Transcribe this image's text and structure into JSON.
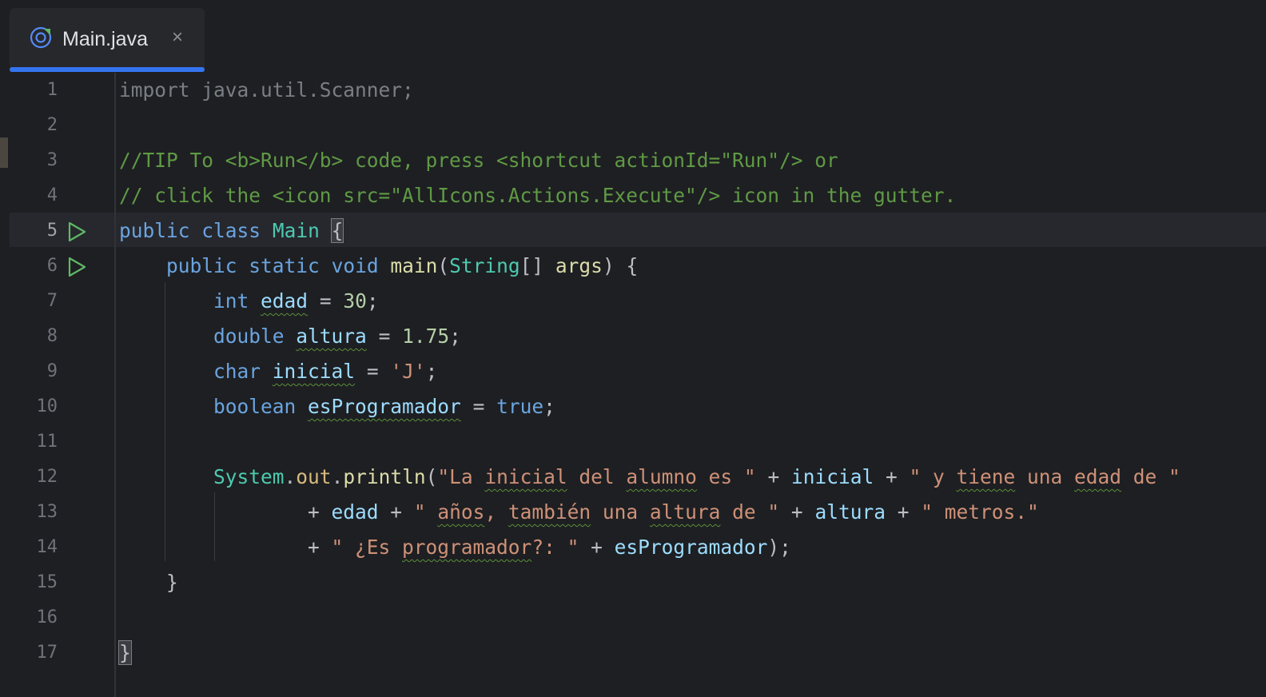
{
  "tab": {
    "title": "Main.java",
    "close_glyph": "×",
    "icon": "java-class-icon",
    "underline_color": "#3574f0"
  },
  "colors": {
    "background": "#1e1f22",
    "keyword": "#6aa4e0",
    "string": "#ce9178",
    "comment": "#5f9a45"
  },
  "lines": [
    {
      "n": "1",
      "code": "import java.util.Scanner;"
    },
    {
      "n": "2",
      "code": ""
    },
    {
      "n": "3",
      "code": "//TIP To <b>Run</b> code, press <shortcut actionId=\"Run\"/> or"
    },
    {
      "n": "4",
      "code": "// click the <icon src=\"AllIcons.Actions.Execute\"/> icon in the gutter."
    },
    {
      "n": "5",
      "code": "public class Main {"
    },
    {
      "n": "6",
      "code": "public static void main(String[] args) {"
    },
    {
      "n": "7",
      "code": "int edad = 30;"
    },
    {
      "n": "8",
      "code": "double altura = 1.75;"
    },
    {
      "n": "9",
      "code": "char inicial = 'J';"
    },
    {
      "n": "10",
      "code": "boolean esProgramador = true;"
    },
    {
      "n": "11",
      "code": ""
    },
    {
      "n": "12",
      "code": "System.out.println(\"La inicial del alumno es \" + inicial + \" y tiene una edad de \""
    },
    {
      "n": "13",
      "code": "+ edad + \" años, también una altura de \" + altura + \" metros.\""
    },
    {
      "n": "14",
      "code": "+ \" ¿Es programador?: \" + esProgramador);"
    },
    {
      "n": "15",
      "code": "}"
    },
    {
      "n": "16",
      "code": ""
    },
    {
      "n": "17",
      "code": "}"
    }
  ],
  "tokens": {
    "l1": "import java.util.Scanner;",
    "l3": "//TIP To <b>Run</b> code, press <shortcut actionId=\"Run\"/> or",
    "l4": "// click the <icon src=\"AllIcons.Actions.Execute\"/> icon in the gutter.",
    "public": "public",
    "class": "class",
    "Main": "Main",
    "lbrace": "{",
    "rbrace": "}",
    "static": "static",
    "void": "void",
    "main": "main",
    "lparen": "(",
    "String": "String",
    "arr": "[] ",
    "args": "args",
    "rparen_sp": ") ",
    "int": "int",
    "edad": "edad",
    "eq": " = ",
    "n30": "30",
    "semi": ";",
    "double": "double",
    "altura": "altura",
    "n175": "1.75",
    "char": "char",
    "inicial": "inicial",
    "cJ": "'J'",
    "boolean": "boolean",
    "esProgramador": "esProgramador",
    "true": "true",
    "System": "System",
    "dot": ".",
    "out": "out",
    "println": "println",
    "s12a_q": "\"La ",
    "s12a_w1": "inicial",
    "s12a_m": " del ",
    "s12a_w2": "alumno",
    "s12a_e": " es \"",
    "plus": " + ",
    "s12b_a": "\" y ",
    "s12b_w1": "tiene",
    "s12b_m": " una ",
    "s12b_w2": "edad",
    "s12b_e": " de \"",
    "plus_lead": "+ ",
    "s13a_a": "\" ",
    "s13a_w1": "años",
    "s13a_m1": ", ",
    "s13a_w2": "también",
    "s13a_m2": " una ",
    "s13a_w3": "altura",
    "s13a_e": " de \"",
    "s13b": "\" metros.\"",
    "s14_a": "\" ¿Es ",
    "s14_w": "programador",
    "s14_e": "?: \"",
    "close_call": ");"
  }
}
